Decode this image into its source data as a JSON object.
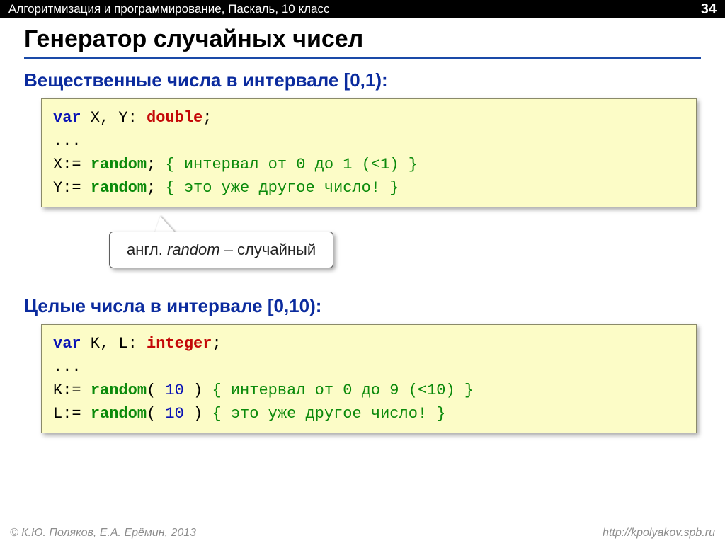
{
  "header": {
    "left": "Алгоритмизация и программирование, Паскаль, 10 класс",
    "page_number": "34"
  },
  "title": "Генератор случайных чисел",
  "section1": {
    "heading": "Вещественные числа в интервале [0,1):",
    "code": {
      "l1_var": "var",
      "l1_vars": " X, Y: ",
      "l1_type": "double",
      "l1_semi": ";",
      "l2": "...",
      "l3_lhs": "X:= ",
      "l3_fn": "random",
      "l3_rest": "; ",
      "l3_comment": "{ интервал от 0 до 1 (<1) }",
      "l4_lhs": "Y:= ",
      "l4_fn": "random",
      "l4_rest": "; ",
      "l4_comment": "{ это уже другое число! }"
    }
  },
  "callout": {
    "prefix": "англ. ",
    "word": "random",
    "suffix": " – случайный"
  },
  "section2": {
    "heading": "Целые числа в интервале [0,10):",
    "code": {
      "l1_var": "var",
      "l1_vars": " K, L: ",
      "l1_type": "integer",
      "l1_semi": ";",
      "l2": "...",
      "l3_lhs": "K:= ",
      "l3_fn": "random",
      "l3_open": "(",
      "l3_num": " 10 ",
      "l3_close": ") ",
      "l3_comment": "{ интервал от 0 до 9 (<10) }",
      "l4_lhs": "L:= ",
      "l4_fn": "random",
      "l4_open": "(",
      "l4_num": " 10 ",
      "l4_close": ") ",
      "l4_comment": "{ это уже другое число! }"
    }
  },
  "footer": {
    "left": "© К.Ю. Поляков, Е.А. Ерёмин, 2013",
    "right": "http://kpolyakov.spb.ru"
  }
}
